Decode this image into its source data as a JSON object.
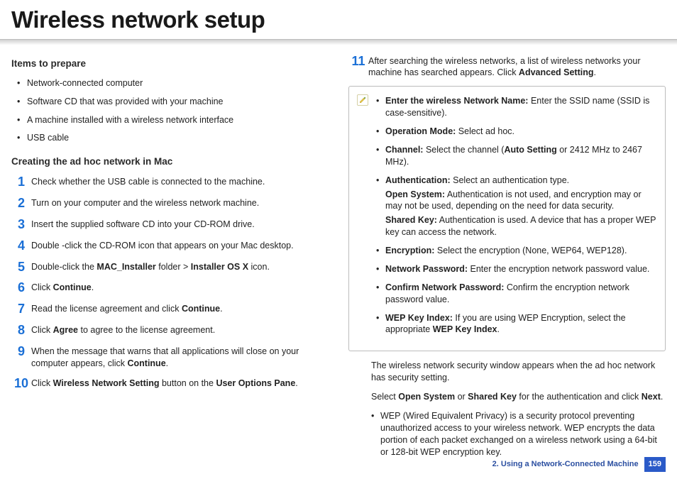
{
  "title": "Wireless network setup",
  "left": {
    "subhead1": "Items to prepare",
    "prep_items": [
      "Network-connected computer",
      "Software CD that was provided with your machine",
      "A machine installed with a wireless network interface",
      "USB cable"
    ],
    "subhead2": "Creating the ad hoc network in Mac",
    "steps": [
      {
        "n": "1",
        "t": "Check whether the USB cable is connected to the machine."
      },
      {
        "n": "2",
        "t": "Turn on your computer and the wireless network machine."
      },
      {
        "n": "3",
        "t": "Insert the supplied software CD into your CD-ROM drive."
      },
      {
        "n": "4",
        "t": "Double -click the CD-ROM icon that appears on your Mac desktop."
      },
      {
        "n": "5",
        "html": "Double-click the <b>MAC_Installer</b> folder &gt; <b>Installer OS X</b> icon."
      },
      {
        "n": "6",
        "html": "Click <b>Continue</b>."
      },
      {
        "n": "7",
        "html": "Read the license agreement and click <b>Continue</b>."
      },
      {
        "n": "8",
        "html": "Click <b>Agree</b> to agree to the license agreement."
      },
      {
        "n": "9",
        "html": "When the message that warns that all applications will close on your computer appears, click <b>Continue</b>."
      },
      {
        "n": "10",
        "html": "Click <b>Wireless Network Setting</b> button on the <b>User Options Pane</b>."
      }
    ]
  },
  "right": {
    "step11": {
      "n": "11",
      "html": "After searching the wireless networks, a list of wireless networks your machine has searched appears. Click <b>Advanced Setting</b>."
    },
    "note_items": [
      {
        "html": "<b>Enter the wireless Network Name:</b> Enter the SSID name (SSID is case-sensitive)."
      },
      {
        "html": "<b>Operation Mode:</b> Select ad hoc."
      },
      {
        "html": "<b>Channel:</b> Select the channel (<b>Auto Setting</b> or 2412 MHz to 2467 MHz)."
      },
      {
        "html": "<b>Authentication:</b> Select an authentication type.<span class=\"sub\"><b>Open System:</b> Authentication is not used, and encryption may or may not be used, depending on the need for data security.</span><span class=\"sub\"><b>Shared Key:</b> Authentication is used. A device that has a proper WEP key can access the network.</span>"
      },
      {
        "html": "<b>Encryption:</b> Select the encryption (None, WEP64, WEP128)."
      },
      {
        "html": "<b>Network Password:</b> Enter the encryption network password value."
      },
      {
        "html": "<b>Confirm Network Password:</b> Confirm the encryption network password value."
      },
      {
        "html": "<b>WEP Key Index:</b> If you are using WEP Encryption, select the appropriate <b>WEP Key Index</b>."
      }
    ],
    "para1": "The wireless network security window appears when the ad hoc network has security setting.",
    "para2_html": "Select <b>Open System</b> or <b>Shared Key</b> for the authentication and click <b>Next</b>.",
    "sub_bullet": "WEP (Wired Equivalent Privacy) is a security protocol preventing unauthorized access to your wireless network. WEP encrypts the data portion of each packet exchanged on a wireless network using a 64-bit or 128-bit WEP encryption key."
  },
  "footer": {
    "section": "2.  Using a Network-Connected Machine",
    "page": "159"
  }
}
